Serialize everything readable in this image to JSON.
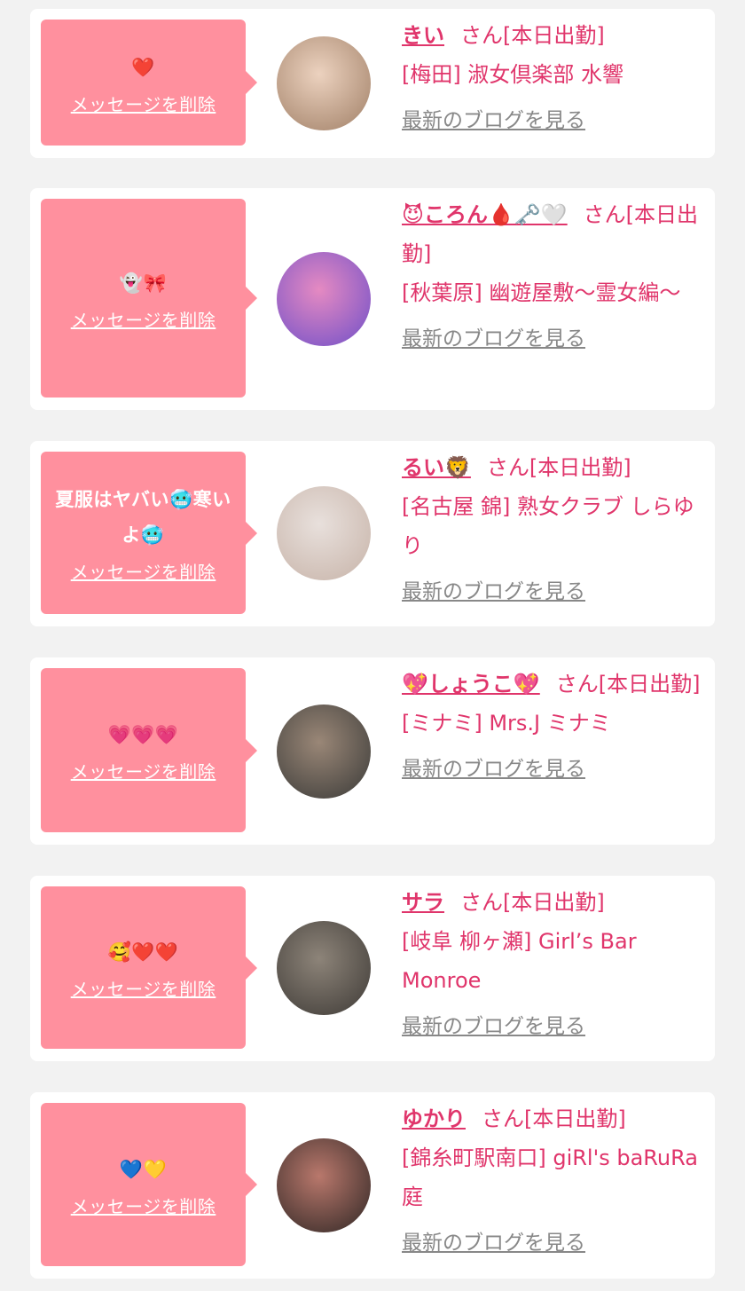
{
  "cards": [
    {
      "message": "❤️",
      "delete_label": "メッセージを削除",
      "name": "きい",
      "status": "さん[本日出勤]",
      "shop": "[梅田] 淑女倶楽部 水響",
      "blog_label": "最新のブログを見る",
      "avatar_colors": [
        "#ecd2bf",
        "#a07f66"
      ]
    },
    {
      "message": "👻🎀",
      "delete_label": "メッセージを削除",
      "name": "😈ころん🩸🗝️🤍",
      "status": "さん[本日出勤]",
      "shop": "[秋葉原] 幽遊屋敷〜霊女編〜",
      "blog_label": "最新のブログを見る",
      "avatar_colors": [
        "#6f4fc8",
        "#e58ac2"
      ]
    },
    {
      "message": "夏服はヤバい🥶寒いよ🥶",
      "delete_label": "メッセージを削除",
      "name": "るい🦁",
      "status": "さん[本日出勤]",
      "shop": "[名古屋 錦] 熟女クラブ しらゆり",
      "blog_label": "最新のブログを見る",
      "avatar_colors": [
        "#e8e0dc",
        "#c7b3a8"
      ]
    },
    {
      "message": "💗💗💗",
      "delete_label": "メッセージを削除",
      "name": "💖しょうこ💖",
      "status": "さん[本日出勤]",
      "shop": "[ミナミ] Mrs.J ミナミ",
      "blog_label": "最新のブログを見る",
      "avatar_colors": [
        "#3a3a38",
        "#9a8777"
      ]
    },
    {
      "message": "🥰❤️❤️",
      "delete_label": "メッセージを削除",
      "name": "サラ",
      "status": "さん[本日出勤]",
      "shop": "[岐阜 柳ヶ瀬] Girl’s Bar Monroe",
      "blog_label": "最新のブログを見る",
      "avatar_colors": [
        "#8d8479",
        "#3e3a36"
      ]
    },
    {
      "message": "💙💛",
      "delete_label": "メッセージを削除",
      "name": "ゆかり",
      "status": "さん[本日出勤]",
      "shop": "[錦糸町駅南口] giRl's baRuRa庭",
      "blog_label": "最新のブログを見る",
      "avatar_colors": [
        "#2e2624",
        "#b9786c"
      ]
    }
  ]
}
